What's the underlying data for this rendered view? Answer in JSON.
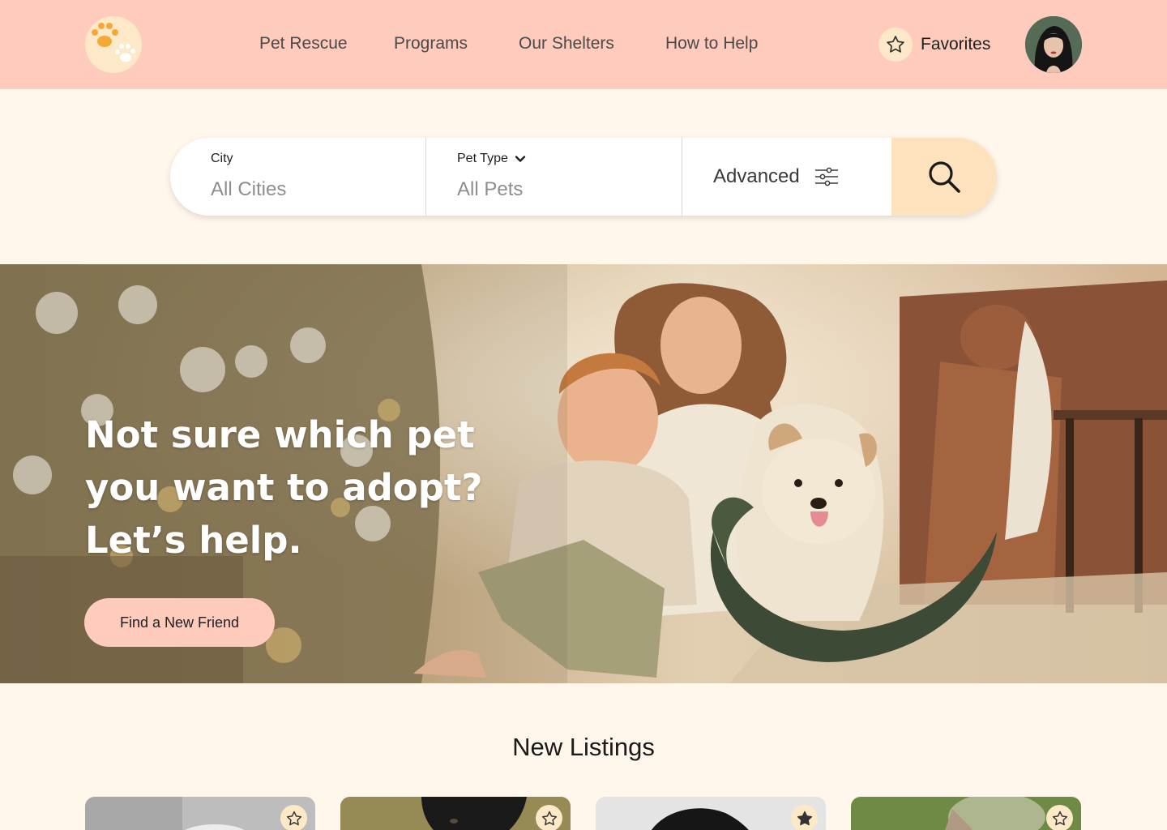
{
  "header": {
    "logo": {
      "icon": "paw-print-icon",
      "accent": "#f4a937"
    },
    "nav": [
      {
        "label": "Pet Rescue"
      },
      {
        "label": "Programs"
      },
      {
        "label": "Our Shelters"
      },
      {
        "label": "How to Help"
      }
    ],
    "favorites_label": "Favorites",
    "favorites_icon": "star-outline-icon",
    "avatar": "user-avatar"
  },
  "search": {
    "city_label": "City",
    "city_value": "All Cities",
    "pet_type_label": "Pet Type",
    "pet_type_value": "All Pets",
    "advanced_label": "Advanced",
    "advanced_icon": "sliders-icon",
    "search_icon": "search-icon"
  },
  "hero": {
    "headline_lines": [
      "Not sure which pet",
      "you want to adopt?",
      "Let’s help."
    ],
    "cta_label": "Find a New Friend"
  },
  "listings": {
    "title": "New Listings",
    "cards": [
      {
        "image": "pet-photo-1",
        "favorited": false
      },
      {
        "image": "pet-photo-2",
        "favorited": false
      },
      {
        "image": "pet-photo-3",
        "favorited": true
      },
      {
        "image": "pet-photo-4",
        "favorited": false
      }
    ]
  },
  "colors": {
    "header_bg": "#ffcbbd",
    "page_bg": "#fff6ec",
    "accent_soft": "#fde2bd",
    "cta_bg": "#ffcbbd"
  }
}
